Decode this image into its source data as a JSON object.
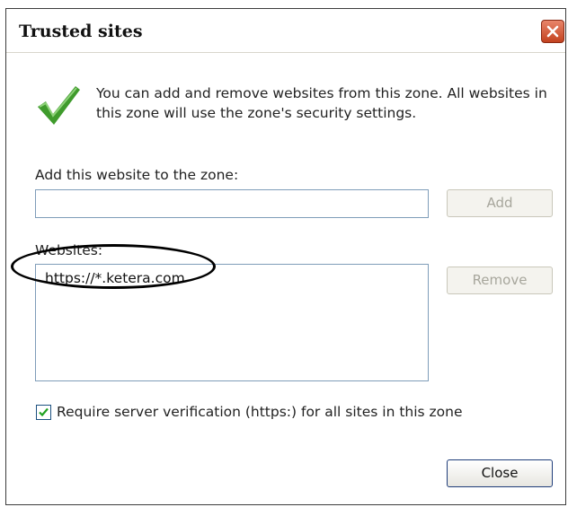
{
  "dialog": {
    "title": "Trusted sites",
    "intro_text": "You can add and remove websites from this zone. All websites in this zone will use the zone's security settings.",
    "add_label": "Add this website to the zone:",
    "add_input_value": "",
    "add_button_label": "Add",
    "websites_label": "Websites:",
    "websites": [
      "https://*.ketera.com"
    ],
    "remove_button_label": "Remove",
    "require_verification_label": "Require server verification (https:) for all sites in this zone",
    "require_verification_checked": true,
    "close_button_label": "Close"
  },
  "icons": {
    "close": "close-icon",
    "status": "green-check-icon"
  },
  "colors": {
    "check_green": "#3f9b2c",
    "titlebar_close": "#c3421f",
    "input_border": "#7f9db9"
  }
}
